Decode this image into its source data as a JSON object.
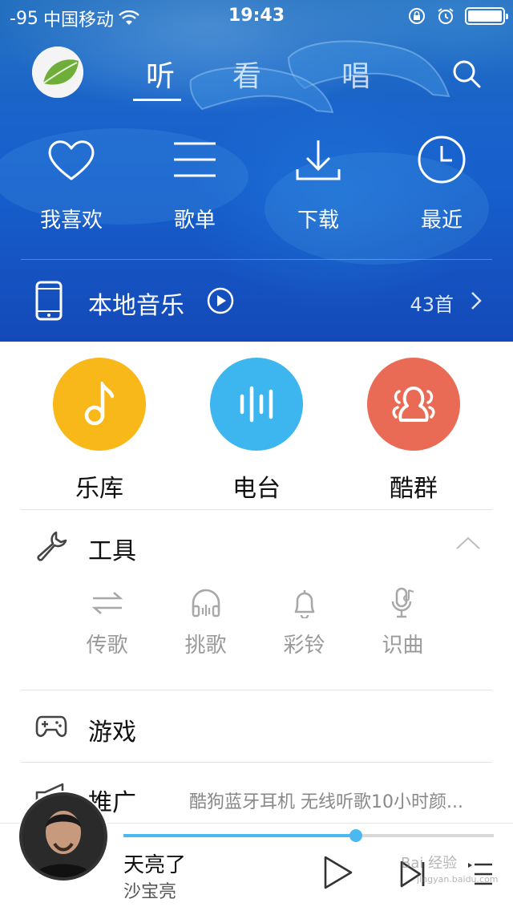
{
  "status_bar": {
    "signal": "-95",
    "carrier": "中国移动",
    "time": "19:43"
  },
  "nav": {
    "tabs": [
      "听",
      "看",
      "唱"
    ],
    "active_tab": "听"
  },
  "quick_actions": [
    {
      "label": "我喜欢",
      "icon": "heart-icon"
    },
    {
      "label": "歌单",
      "icon": "list-icon"
    },
    {
      "label": "下载",
      "icon": "download-icon"
    },
    {
      "label": "最近",
      "icon": "clock-icon"
    }
  ],
  "local_music": {
    "title": "本地音乐",
    "count": "43首"
  },
  "categories": [
    {
      "label": "乐库",
      "color": "#f8b81a",
      "icon": "music-note-icon"
    },
    {
      "label": "电台",
      "color": "#3db5ef",
      "icon": "radio-wave-icon"
    },
    {
      "label": "酷群",
      "color": "#e96b55",
      "icon": "group-icon"
    }
  ],
  "tools": {
    "title": "工具",
    "items": [
      {
        "label": "传歌",
        "icon": "transfer-icon"
      },
      {
        "label": "挑歌",
        "icon": "headphones-icon"
      },
      {
        "label": "彩铃",
        "icon": "bell-icon"
      },
      {
        "label": "识曲",
        "icon": "mic-music-icon"
      }
    ]
  },
  "games": {
    "title": "游戏"
  },
  "promo": {
    "title": "推广",
    "text": "酷狗蓝牙耳机 无线听歌10小时颜..."
  },
  "player": {
    "song": "天亮了",
    "artist": "沙宝亮",
    "progress": 0.627
  },
  "watermark": {
    "line1": "Bai 经验",
    "line2": "jingyan.baidu.com"
  },
  "colors": {
    "accent": "#4bb8ef",
    "header_blue": "#1a64cc"
  }
}
